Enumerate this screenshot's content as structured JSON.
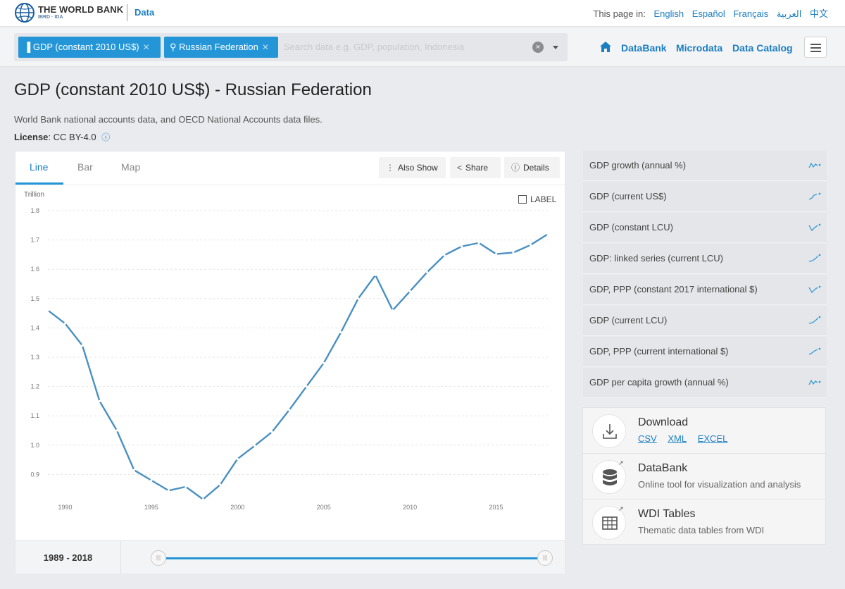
{
  "header": {
    "brand": "THE WORLD BANK",
    "brand_sub": "IBRD · IDA",
    "section": "Data",
    "languages_label": "This page in:",
    "languages": [
      "English",
      "Español",
      "Français",
      "العربية",
      "中文"
    ]
  },
  "search": {
    "chips": [
      "GDP (constant 2010 US$)",
      "Russian Federation"
    ],
    "placeholder": "Search data e.g. GDP, population, Indonesia"
  },
  "nav": {
    "links": [
      "DataBank",
      "Microdata",
      "Data Catalog"
    ]
  },
  "page": {
    "title": "GDP (constant 2010 US$) - Russian Federation",
    "description": "World Bank national accounts data, and OECD National Accounts data files.",
    "license_label": "License",
    "license_value": ": CC BY-4.0"
  },
  "tabs": [
    "Line",
    "Bar",
    "Map"
  ],
  "toolbar": [
    "Also Show",
    "Share",
    "Details"
  ],
  "label_toggle": "LABEL",
  "chart_data": {
    "type": "line",
    "unit_label": "Trillion",
    "x": [
      1989,
      1990,
      1991,
      1992,
      1993,
      1994,
      1995,
      1996,
      1997,
      1998,
      1999,
      2000,
      2001,
      2002,
      2003,
      2004,
      2005,
      2006,
      2007,
      2008,
      2009,
      2010,
      2011,
      2012,
      2013,
      2014,
      2015,
      2016,
      2017,
      2018
    ],
    "values": [
      1.46,
      1.415,
      1.34,
      1.15,
      1.05,
      0.915,
      0.88,
      0.845,
      0.858,
      0.815,
      0.865,
      0.953,
      0.998,
      1.045,
      1.12,
      1.2,
      1.28,
      1.385,
      1.5,
      1.58,
      1.46,
      1.525,
      1.59,
      1.648,
      1.678,
      1.69,
      1.652,
      1.657,
      1.683,
      1.72
    ],
    "ylim": [
      0.8,
      1.8
    ],
    "yticks": [
      "0.9",
      "1.0",
      "1.1",
      "1.2",
      "1.3",
      "1.4",
      "1.5",
      "1.6",
      "1.7",
      "1.8"
    ],
    "xticks": [
      "1990",
      "1995",
      "2000",
      "2005",
      "2010",
      "2015"
    ],
    "color": "#4a90c2",
    "grid": true
  },
  "range_label": "1989 - 2018",
  "related": [
    "GDP growth (annual %)",
    "GDP (current US$)",
    "GDP (constant LCU)",
    "GDP: linked series (current LCU)",
    "GDP, PPP (constant 2017 international $)",
    "GDP (current LCU)",
    "GDP, PPP (current international $)",
    "GDP per capita growth (annual %)"
  ],
  "download": {
    "title": "Download",
    "formats": [
      "CSV",
      "XML",
      "EXCEL"
    ],
    "databank_title": "DataBank",
    "databank_desc": "Online tool for visualization and analysis",
    "wdi_title": "WDI Tables",
    "wdi_desc": "Thematic data tables from WDI"
  },
  "colors": {
    "accent": "#2496d8",
    "link": "#1a7ec2"
  }
}
